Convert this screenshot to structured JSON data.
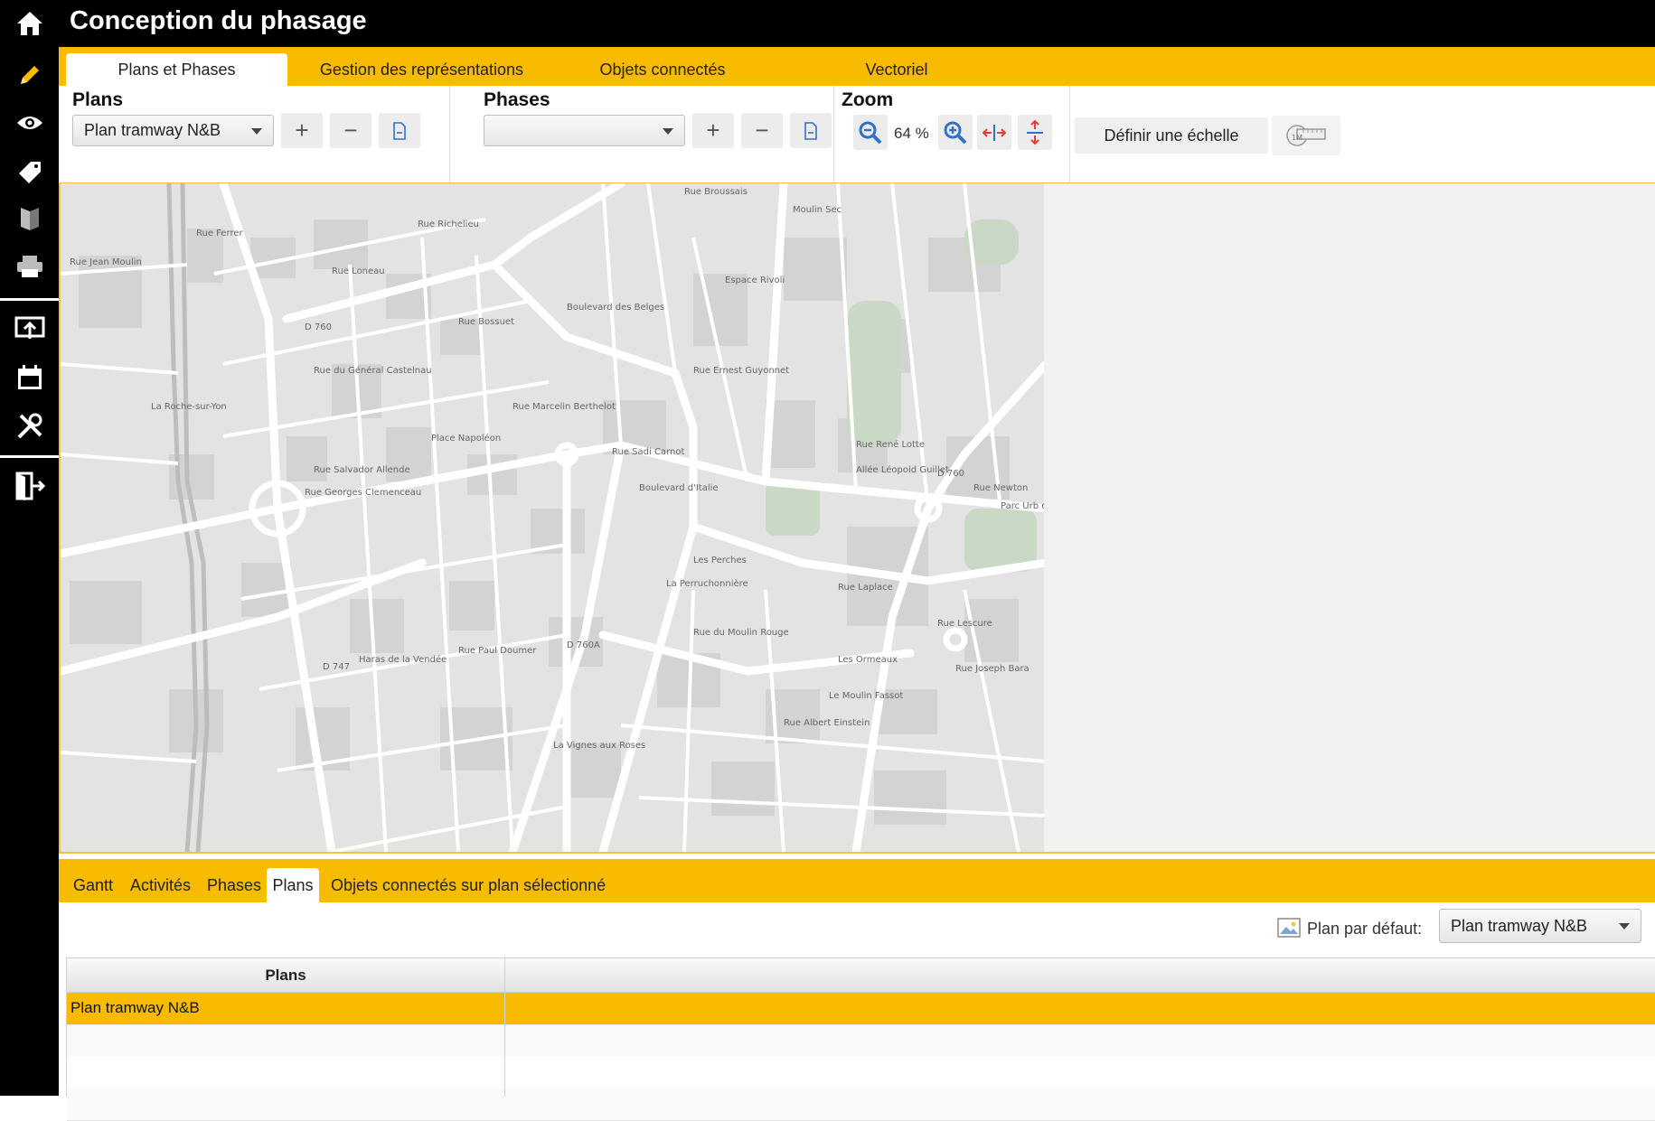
{
  "app": {
    "title": "Conception du phasage"
  },
  "top_tabs": [
    {
      "label": "Plans et Phases",
      "active": true
    },
    {
      "label": "Gestion des représentations",
      "active": false
    },
    {
      "label": "Objets connectés",
      "active": false
    },
    {
      "label": "Vectoriel",
      "active": false
    }
  ],
  "toolbar": {
    "plans": {
      "title": "Plans",
      "selected": "Plan tramway N&B"
    },
    "phases": {
      "title": "Phases",
      "selected": ""
    },
    "zoom": {
      "title": "Zoom",
      "level": "64 %"
    },
    "define_scale_label": "Définir une échelle"
  },
  "map": {
    "labels": [
      "Rue Richelieu",
      "Rue Ferrer",
      "Rue Jean Moulin",
      "D 760",
      "Rue Loneau",
      "Rue du Général Castelnau",
      "Rue Bossuet",
      "Boulevard des Belges",
      "Rue Broussais",
      "Moulin Sec",
      "Espace Rivoli",
      "Rue Ernest Guyonnet",
      "Rue Marcelin Berthelot",
      "La Roche-sur-Yon",
      "Place Napoléon",
      "Rue Salvador Allende",
      "Rue Georges Clemenceau",
      "Rue Sadi Carnot",
      "Boulevard d'Italie",
      "Allée Léopold Guillet",
      "D 760",
      "Parc Urb des Ouda",
      "Les Perches",
      "La Perruchonnière",
      "Rue Laplace",
      "Les Ormeaux",
      "Le Moulin Fassot",
      "Rue du Moulin Rouge",
      "D 760A",
      "D 747",
      "Haras de la Vendée",
      "Rue Paul Doumer",
      "La Vignes aux Roses",
      "Rue Albert Einstein",
      "Rue Joseph Bara",
      "Rue Lescure",
      "Rue Newton",
      "Rue René Lotte"
    ]
  },
  "bottom_tabs": [
    {
      "label": "Gantt",
      "active": false
    },
    {
      "label": "Activités",
      "active": false
    },
    {
      "label": "Phases",
      "active": false
    },
    {
      "label": "Plans",
      "active": true
    },
    {
      "label": "Objets connectés sur plan sélectionné",
      "active": false
    }
  ],
  "default_plan": {
    "label": "Plan par défaut:",
    "selected": "Plan tramway N&B"
  },
  "plans_table": {
    "header": "Plans",
    "rows": [
      "Plan tramway N&B",
      "",
      "",
      ""
    ]
  },
  "colors": {
    "accent": "#f9bb00",
    "chrome": "#000000",
    "selected_row": "#f9bb00",
    "icon_blue": "#2e73c7",
    "icon_red": "#e23c3c"
  },
  "rail_icons": [
    "home-icon",
    "pencil-icon",
    "eye-icon",
    "tag-icon",
    "book-icon",
    "printer-icon",
    "export-screen-icon",
    "calendar-icon",
    "tools-icon",
    "exit-icon"
  ]
}
